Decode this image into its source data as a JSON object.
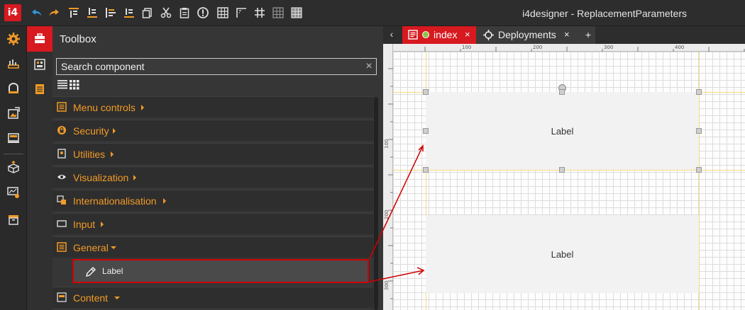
{
  "app": {
    "logo": "i4",
    "title": "i4designer - ReplacementParameters"
  },
  "toolbar": {
    "icons": [
      "undo-icon",
      "redo-icon",
      "align-top-icon",
      "align-middle-icon",
      "align-bottom-icon",
      "distribute-icon",
      "copy-icon",
      "cut-icon",
      "paste-icon",
      "info-icon",
      "grid-icon",
      "snap-icon",
      "grid-lines-icon",
      "grid-dots-icon",
      "grid-fill-icon"
    ]
  },
  "colors": {
    "brand": "#d71920",
    "accent": "#f29b26",
    "highlight": "#d10000"
  },
  "toolbox": {
    "title": "Toolbox",
    "search_placeholder": "Search component",
    "clear": "×",
    "categories": [
      {
        "label": "Menu controls",
        "icon": "menu-controls-icon",
        "expanded": false
      },
      {
        "label": "Security",
        "icon": "lock-icon",
        "expanded": false
      },
      {
        "label": "Utilities",
        "icon": "utilities-icon",
        "expanded": false
      },
      {
        "label": "Visualization",
        "icon": "eye-icon",
        "expanded": false
      },
      {
        "label": "Internationalisation",
        "icon": "language-icon",
        "expanded": false
      },
      {
        "label": "Input",
        "icon": "input-icon",
        "expanded": false
      },
      {
        "label": "General",
        "icon": "general-icon",
        "expanded": true
      },
      {
        "label": "Content",
        "icon": "content-icon",
        "expanded": false
      }
    ],
    "general_items": [
      {
        "label": "Label",
        "icon": "pencil-icon"
      }
    ]
  },
  "tabs": {
    "back": "‹",
    "items": [
      {
        "label": "index",
        "active": true,
        "close": "×"
      },
      {
        "label": "Deployments",
        "active": false,
        "close": "×"
      }
    ],
    "add": "+"
  },
  "ruler": {
    "top_labels": [
      "100",
      "200",
      "300",
      "400"
    ],
    "left_labels": [
      "100",
      "200",
      "300"
    ]
  },
  "canvas": {
    "components": [
      {
        "label": "Label",
        "selected": true
      },
      {
        "label": "Label",
        "selected": false
      }
    ]
  }
}
